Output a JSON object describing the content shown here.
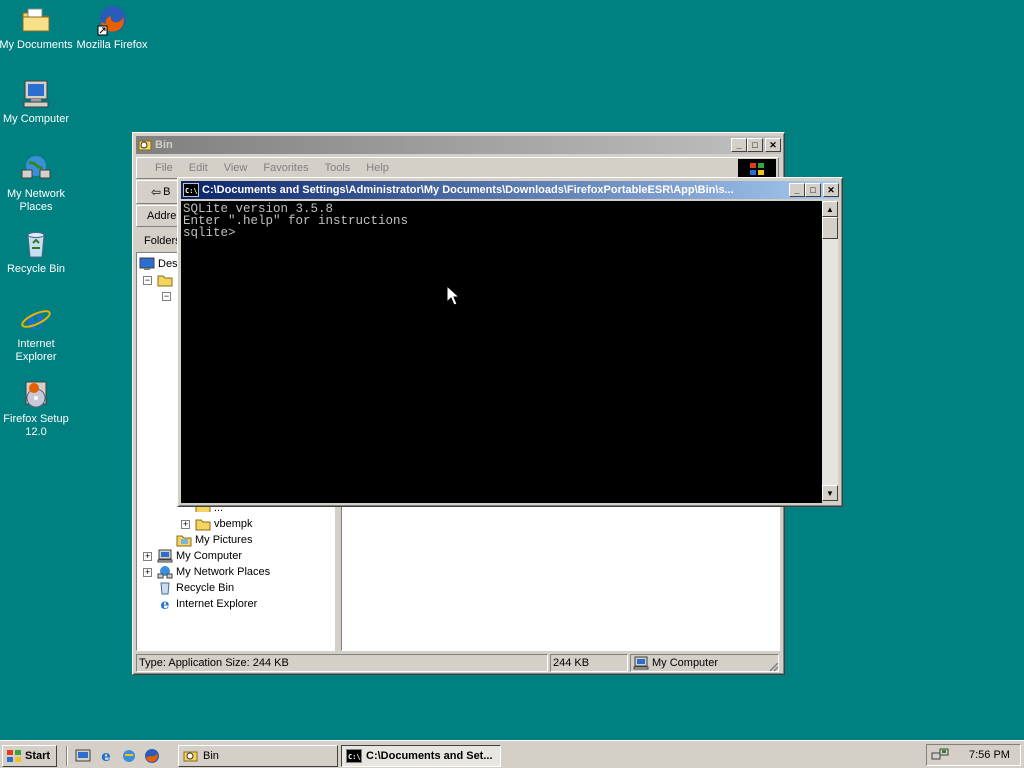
{
  "desktop": {
    "icons": [
      {
        "label": "My Documents",
        "icon": "folder-documents-icon"
      },
      {
        "label": "Mozilla Firefox",
        "icon": "firefox-icon"
      },
      {
        "label": "My Computer",
        "icon": "computer-icon"
      },
      {
        "label": "My Network Places",
        "icon": "network-icon"
      },
      {
        "label": "Recycle Bin",
        "icon": "recycle-bin-icon"
      },
      {
        "label": "Internet Explorer",
        "icon": "ie-icon"
      },
      {
        "label": "Firefox Setup 12.0",
        "icon": "installer-icon"
      }
    ]
  },
  "explorer": {
    "title": "Bin",
    "menu": [
      "File",
      "Edit",
      "View",
      "Favorites",
      "Tools",
      "Help"
    ],
    "back_label": "B",
    "address_label": "Addre",
    "folders_label": "Folders",
    "tree": {
      "desktop_label": "Des",
      "partial_label": "...",
      "vbempk": "vbempk",
      "my_pictures": "My Pictures",
      "my_computer": "My Computer",
      "my_network_places": "My Network Places",
      "recycle_bin": "Recycle Bin",
      "internet_explorer": "Internet Explorer"
    },
    "status": {
      "info": "Type: Application Size: 244 KB",
      "size": "244 KB",
      "zone": "My Computer"
    }
  },
  "console": {
    "title": "C:\\Documents and Settings\\Administrator\\My Documents\\Downloads\\FirefoxPortableESR\\App\\Bin\\s...",
    "lines": [
      "SQLite version 3.5.8",
      "Enter \".help\" for instructions",
      "sqlite>"
    ]
  },
  "taskbar": {
    "start_label": "Start",
    "tasks": [
      {
        "label": "Bin",
        "active": false
      },
      {
        "label": "C:\\Documents and Set...",
        "active": true
      }
    ],
    "clock": "7:56 PM"
  },
  "colors": {
    "desktop": "#008080",
    "active_title": "#0a246a",
    "inactive_title": "#808080"
  }
}
